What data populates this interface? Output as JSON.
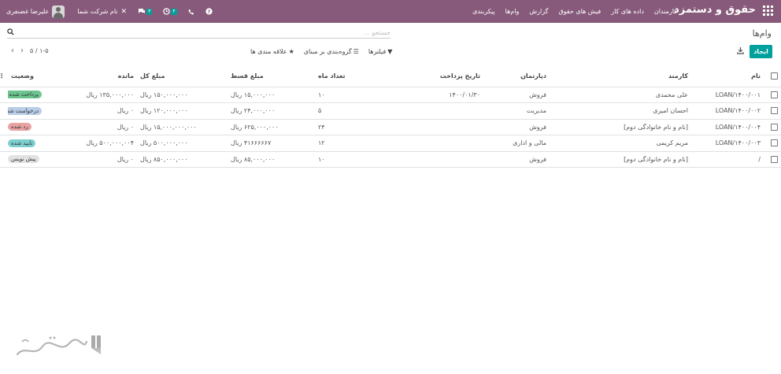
{
  "navbar": {
    "brand": "حقوق و دستمزد",
    "menu": [
      "کارمندان",
      "داده های کار",
      "فیش های حقوق",
      "گزارش",
      "وام‌ها",
      "پیکربندی"
    ],
    "user_name": "علیرضا غضنفری",
    "company": "نام شرکت شما",
    "activity_count": "۴",
    "messages_count": "۳"
  },
  "breadcrumb": "وام‌ها",
  "search": {
    "placeholder": "جستجو ..."
  },
  "buttons": {
    "create": "ایجاد"
  },
  "filters": {
    "filter": "فیلترها",
    "group_by": "گروه‌بندی بر مبنای",
    "favorites": "علاقه مندی ها"
  },
  "pager": {
    "value": "۱-۵ / ۵"
  },
  "table": {
    "headers": {
      "name": "نام",
      "employee": "کارمند",
      "department": "دپارتمان",
      "payment_date": "تاریخ پرداخت",
      "months": "تعداد ماه",
      "installment": "مبلغ قسط",
      "total": "مبلغ کل",
      "residual": "مانده",
      "status": "وضعیت"
    },
    "rows": [
      {
        "name": "LOAN/۱۴۰۰/۰۰۱",
        "employee": "علی محمدی",
        "department": "فروش",
        "payment_date": "۱۴۰۰/۰۱/۳۰",
        "months": "۱۰",
        "installment": "۱۵,۰۰۰,۰۰۰ ریال",
        "total": "۱۵۰,۰۰۰,۰۰۰ ریال",
        "residual": "۱۳۵,۰۰۰,۰۰۰ ریال",
        "status": "پرداخت شده",
        "status_color": "#6cc58f"
      },
      {
        "name": "LOAN/۱۴۰۰/۰۰۲",
        "employee": "احسان امیری",
        "department": "مدیریت",
        "payment_date": "",
        "months": "۵",
        "installment": "۲۴,۰۰۰,۰۰۰ ریال",
        "total": "۱۲۰,۰۰۰,۰۰۰ ریال",
        "residual": "۰ ریال",
        "status": "درخواست شده",
        "status_color": "#b9cde9"
      },
      {
        "name": "LOAN/۱۴۰۰/۰۰۴",
        "employee": "[نام و نام خانوادگی دوم]",
        "department": "فروش",
        "payment_date": "",
        "months": "۲۴",
        "installment": "۶۲۵,۰۰۰,۰۰۰ ریال",
        "total": "۱۵,۰۰۰,۰۰۰,۰۰۰ ریال",
        "residual": "۰ ریال",
        "status": "رد شده",
        "status_color": "#e9a3a3"
      },
      {
        "name": "LOAN/۱۴۰۰/۰۰۳",
        "employee": "مریم کریمی",
        "department": "مالی و اداری",
        "payment_date": "",
        "months": "۱۲",
        "installment": "۴۱۶۶۶۶۶۷ ریال",
        "total": "۵۰۰,۰۰۰,۰۰۰ ریال",
        "residual": "۵۰۰,۰۰۰,۰۰۴ ریال",
        "status": "تایید شده",
        "status_color": "#7ecfd0"
      },
      {
        "name": "/",
        "employee": "[نام و نام خانوادگی دوم]",
        "department": "فروش",
        "payment_date": "",
        "months": "۱۰",
        "installment": "۸۵,۰۰۰,۰۰۰ ریال",
        "total": "۸۵۰,۰۰۰,۰۰۰ ریال",
        "residual": "۰ ریال",
        "status": "پیش نویس",
        "status_color": "#e2e2e2"
      }
    ]
  },
  "colors": {
    "navbar": "#875A7B",
    "primary": "#00A09D"
  }
}
